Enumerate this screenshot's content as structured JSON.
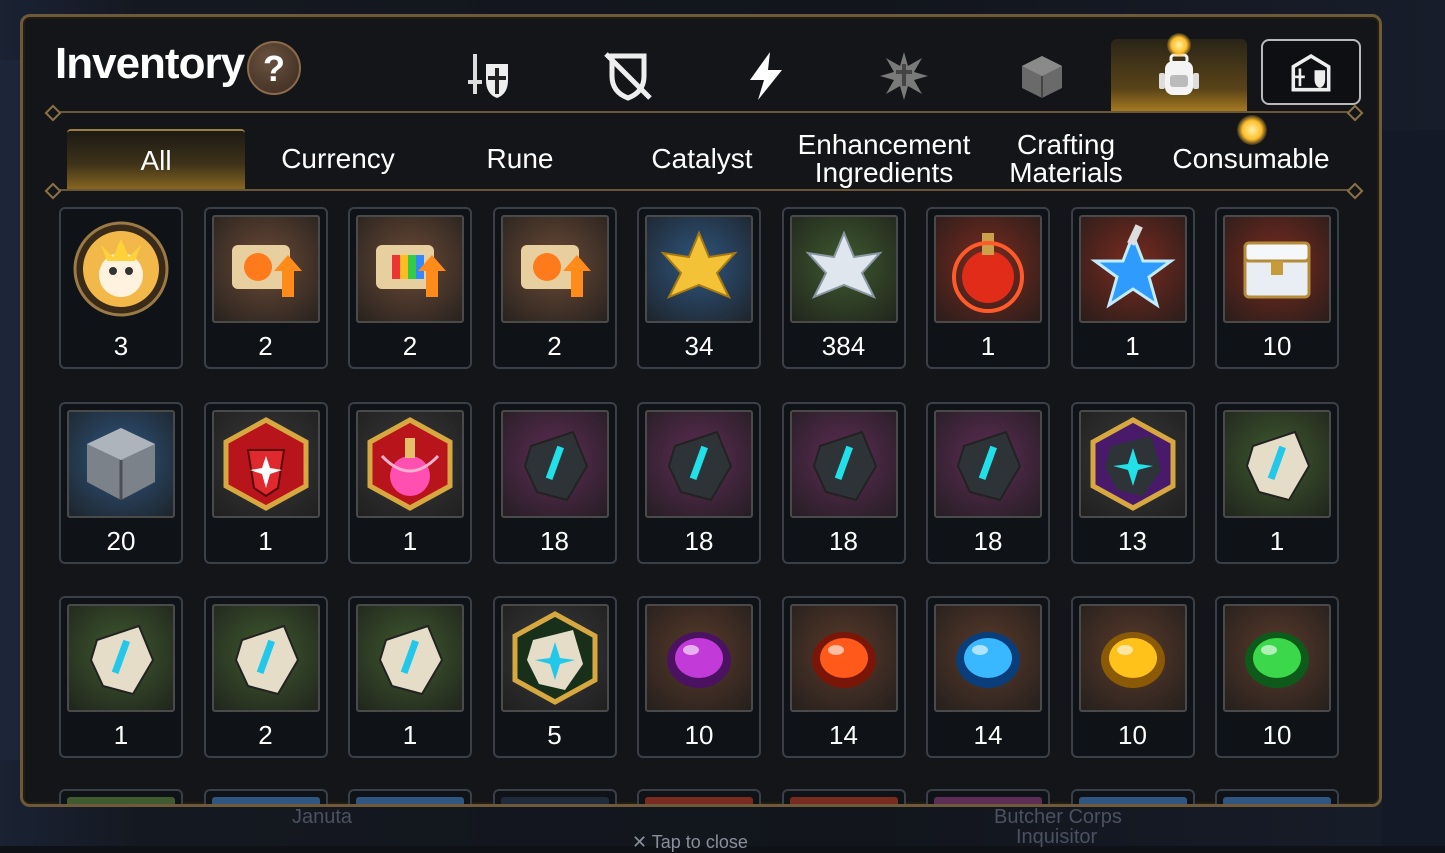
{
  "window": {
    "title": "Inventory",
    "help_label": "?"
  },
  "colors": {
    "accent": "#d9a43a",
    "panel_border": "#6e5a3a",
    "active_tab": "#8c6a22"
  },
  "top_tabs": [
    {
      "name": "equipment-tab",
      "icon": "sword-shield-icon",
      "active": false
    },
    {
      "name": "unequip-tab",
      "icon": "crossed-shield-icon",
      "active": false
    },
    {
      "name": "artifact-tab",
      "icon": "lightning-icon",
      "active": false
    },
    {
      "name": "material-tab",
      "icon": "burst-icon",
      "active": false
    },
    {
      "name": "pet-tab",
      "icon": "cube-icon",
      "active": false
    },
    {
      "name": "item-tab",
      "icon": "backpack-icon",
      "active": true
    },
    {
      "name": "storage-tab",
      "icon": "castle-icon",
      "active": false
    }
  ],
  "categories": [
    {
      "label": "All",
      "active": true
    },
    {
      "label": "Currency",
      "active": false
    },
    {
      "label": "Rune",
      "active": false
    },
    {
      "label": "Catalyst",
      "active": false
    },
    {
      "label": "Enhancement Ingredients",
      "line1": "Enhancement",
      "line2": "Ingredients",
      "active": false
    },
    {
      "label": "Crafting Materials",
      "line1": "Crafting",
      "line2": "Materials",
      "active": false
    },
    {
      "label": "Consumable",
      "active": false
    }
  ],
  "items": [
    {
      "icon": "mascot-coin-icon",
      "count": "3"
    },
    {
      "icon": "scroll-upgrade-orange-icon",
      "count": "2"
    },
    {
      "icon": "scroll-upgrade-rainbow-icon",
      "count": "2"
    },
    {
      "icon": "scroll-upgrade-orange-icon",
      "count": "2"
    },
    {
      "icon": "gold-crystal-flower-icon",
      "count": "34"
    },
    {
      "icon": "silver-crystal-flower-icon",
      "count": "384"
    },
    {
      "icon": "red-potion-icon",
      "count": "1"
    },
    {
      "icon": "blue-star-potion-icon",
      "count": "1"
    },
    {
      "icon": "silver-chest-icon",
      "count": "10"
    },
    {
      "icon": "silver-cube-icon",
      "count": "20"
    },
    {
      "icon": "red-hex-rune-icon",
      "count": "1"
    },
    {
      "icon": "pink-potion-hex-icon",
      "count": "1"
    },
    {
      "icon": "sword-stone-purple-icon",
      "count": "18"
    },
    {
      "icon": "helm-stone-purple-icon",
      "count": "18"
    },
    {
      "icon": "armor-stone-purple-icon",
      "count": "18"
    },
    {
      "icon": "boot-stone-purple-icon",
      "count": "18"
    },
    {
      "icon": "star-stone-hex-purple-icon",
      "count": "13"
    },
    {
      "icon": "sword-stone-green-icon",
      "count": "1"
    },
    {
      "icon": "helm-stone-green-icon",
      "count": "1"
    },
    {
      "icon": "armor-stone-green-icon",
      "count": "2"
    },
    {
      "icon": "boot-stone-green-icon",
      "count": "1"
    },
    {
      "icon": "star-stone-hex-green-icon",
      "count": "5"
    },
    {
      "icon": "purple-moon-gem-icon",
      "count": "10"
    },
    {
      "icon": "red-flame-gem-icon",
      "count": "14"
    },
    {
      "icon": "blue-ice-gem-icon",
      "count": "14"
    },
    {
      "icon": "yellow-bolt-gem-icon",
      "count": "10"
    },
    {
      "icon": "green-wind-gem-icon",
      "count": "10"
    }
  ],
  "background": {
    "bottom_left": "Januta",
    "bottom_center": "Tap to close",
    "bottom_right_line1": "Butcher Corps",
    "bottom_right_line2": "Inquisitor"
  }
}
